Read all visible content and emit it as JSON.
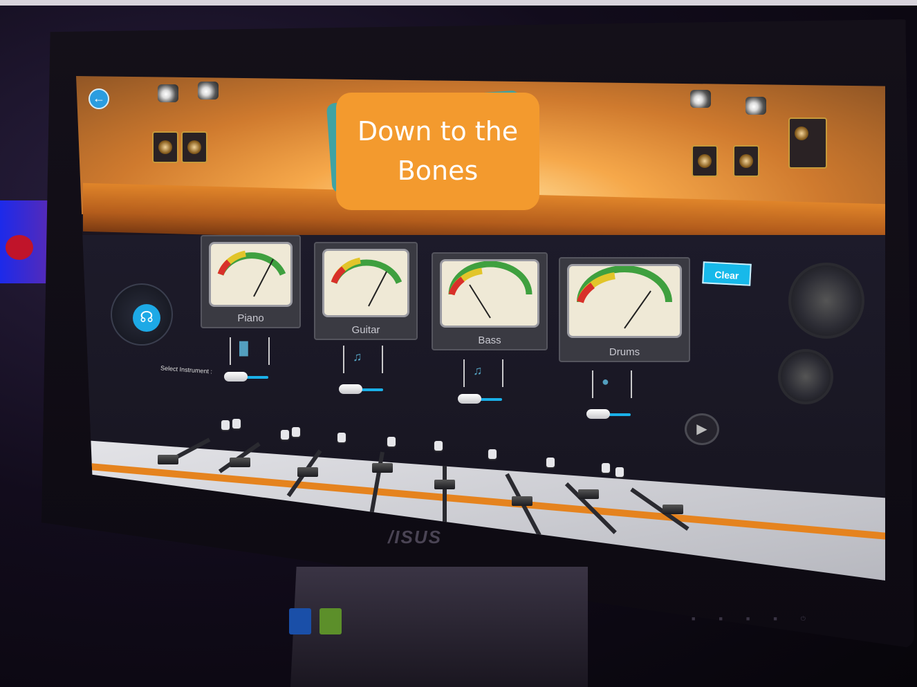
{
  "app": {
    "title": "Down to the Bones",
    "back_icon": "arrow-left-icon",
    "headphones_icon": "headphones-icon"
  },
  "controls": {
    "select_label": "Select Instrument :",
    "clear_label": "Clear",
    "play_icon": "play-icon"
  },
  "instruments": [
    {
      "name": "Piano",
      "icon": "piano-icon"
    },
    {
      "name": "Guitar",
      "icon": "guitar-icon"
    },
    {
      "name": "Bass",
      "icon": "bass-guitar-icon"
    },
    {
      "name": "Drums",
      "icon": "drum-kit-icon"
    }
  ],
  "hardware": {
    "brand": "/ISUS"
  },
  "colors": {
    "accent_orange": "#f39a2e",
    "accent_blue": "#17b9ea",
    "title_back": "#3fa3a3"
  }
}
